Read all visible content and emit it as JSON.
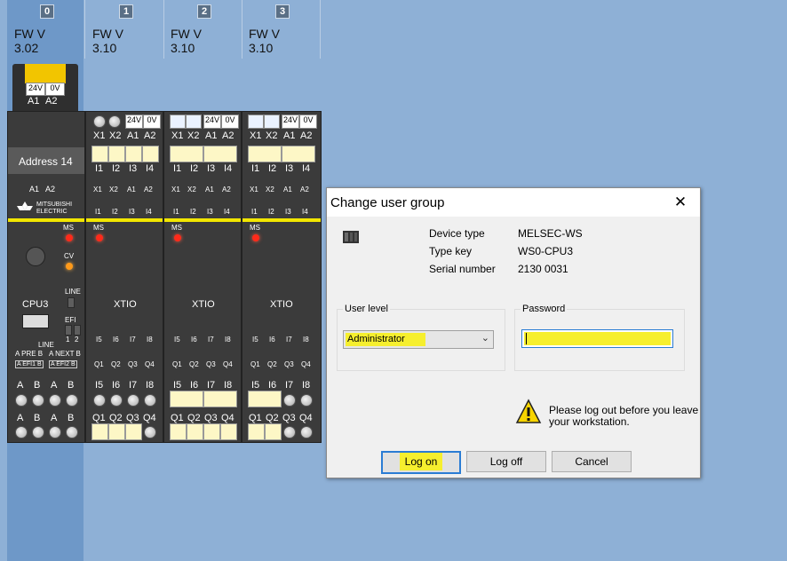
{
  "slots": [
    {
      "num": "0",
      "fw": "FW V",
      "ver": "3.02"
    },
    {
      "num": "1",
      "fw": "FW V",
      "ver": "3.10"
    },
    {
      "num": "2",
      "fw": "FW V",
      "ver": "3.10"
    },
    {
      "num": "3",
      "fw": "FW V",
      "ver": "3.10"
    }
  ],
  "cpu": {
    "cap_24v": "24V",
    "cap_0v": "0V",
    "cap_a1": "A1",
    "cap_a2": "A2",
    "address": "Address 14",
    "top_a1": "A1",
    "top_a2": "A2",
    "brand1": "MITSUBISHI",
    "brand2": "ELECTRIC",
    "ms": "MS",
    "cv": "CV",
    "line": "LINE",
    "efi": "EFI",
    "efi_1": "1",
    "efi_2": "2",
    "name": "CPU3",
    "line2": "LINE",
    "a_pre_b": "A PRE B",
    "a_next_b": "A NEXT B",
    "a_efi1_b": "A EFI1 B",
    "a_efi2_b": "A EFI2 B",
    "row1": [
      "A",
      "B",
      "A",
      "B"
    ],
    "row2": [
      "A",
      "B",
      "A",
      "B"
    ]
  },
  "xtio": {
    "name": "XTIO",
    "ms": "MS",
    "top_labels": [
      "X1",
      "X2",
      "A1",
      "A2"
    ],
    "v24": "24V",
    "v0": "0V",
    "in_top": [
      "I1",
      "I2",
      "I3",
      "I4"
    ],
    "in_bot": [
      "I5",
      "I6",
      "I7",
      "I8"
    ],
    "out": [
      "Q1",
      "Q2",
      "Q3",
      "Q4"
    ]
  },
  "dialog": {
    "title": "Change user group",
    "close": "✕",
    "device_type_label": "Device type",
    "device_type_value": "MELSEC-WS",
    "type_key_label": "Type key",
    "type_key_value": "WS0-CPU3",
    "serial_label": "Serial number",
    "serial_value": "2130 0031",
    "user_level_label": "User level",
    "user_level_value": "Administrator",
    "password_label": "Password",
    "warning_line1": "Please log out before you leave",
    "warning_line2": "your workstation.",
    "logon": "Log on",
    "logoff": "Log off",
    "cancel": "Cancel"
  }
}
